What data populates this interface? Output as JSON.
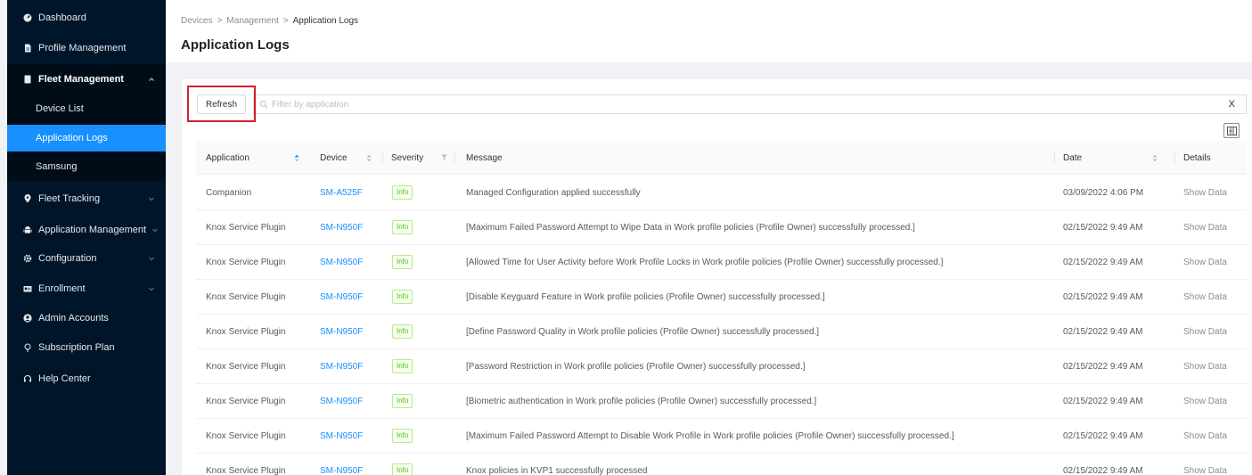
{
  "sidebar": {
    "items": [
      {
        "label": "Dashboard",
        "icon": "dashboard-icon"
      },
      {
        "label": "Profile Management",
        "icon": "file-icon"
      },
      {
        "label": "Fleet Management",
        "icon": "mobile-icon",
        "expanded": true
      },
      {
        "label": "Fleet Tracking",
        "icon": "location-icon"
      },
      {
        "label": "Application Management",
        "icon": "android-icon"
      },
      {
        "label": "Configuration",
        "icon": "gear-icon"
      },
      {
        "label": "Enrollment",
        "icon": "id-card-icon"
      },
      {
        "label": "Admin Accounts",
        "icon": "user-circle-icon"
      },
      {
        "label": "Subscription Plan",
        "icon": "bulb-icon"
      },
      {
        "label": "Help Center",
        "icon": "headset-icon"
      }
    ],
    "fleet_submenu": [
      {
        "label": "Device List",
        "active": false
      },
      {
        "label": "Application Logs",
        "active": true
      },
      {
        "label": "Samsung",
        "active": false
      }
    ]
  },
  "breadcrumb": {
    "items": [
      "Devices",
      "Management",
      "Application Logs"
    ],
    "separator": ">"
  },
  "page": {
    "title": "Application Logs"
  },
  "toolbar": {
    "refresh_label": "Refresh",
    "filter_placeholder": "Filter by application",
    "filter_value": "",
    "clear_label": "X"
  },
  "table": {
    "columns": {
      "application": "Application",
      "device": "Device",
      "severity": "Severity",
      "message": "Message",
      "date": "Date",
      "details": "Details"
    },
    "rows": [
      {
        "application": "Companion",
        "device": "SM-A525F",
        "severity": "Info",
        "message": "Managed Configuration applied successfully",
        "date": "03/09/2022 4:06 PM",
        "details": "Show Data"
      },
      {
        "application": "Knox Service Plugin",
        "device": "SM-N950F",
        "severity": "Info",
        "message": "[Maximum Failed Password Attempt to Wipe Data in Work profile policies (Profile Owner) successfully processed.]",
        "date": "02/15/2022 9:49 AM",
        "details": "Show Data"
      },
      {
        "application": "Knox Service Plugin",
        "device": "SM-N950F",
        "severity": "Info",
        "message": "[Allowed Time for User Activity before Work Profile Locks in Work profile policies (Profile Owner) successfully processed.]",
        "date": "02/15/2022 9:49 AM",
        "details": "Show Data"
      },
      {
        "application": "Knox Service Plugin",
        "device": "SM-N950F",
        "severity": "Info",
        "message": "[Disable Keyguard Feature in Work profile policies (Profile Owner) successfully processed.]",
        "date": "02/15/2022 9:49 AM",
        "details": "Show Data"
      },
      {
        "application": "Knox Service Plugin",
        "device": "SM-N950F",
        "severity": "Info",
        "message": "[Define Password Quality in Work profile policies (Profile Owner) successfully processed.]",
        "date": "02/15/2022 9:49 AM",
        "details": "Show Data"
      },
      {
        "application": "Knox Service Plugin",
        "device": "SM-N950F",
        "severity": "Info",
        "message": "[Password Restriction in Work profile policies (Profile Owner) successfully processed.]",
        "date": "02/15/2022 9:49 AM",
        "details": "Show Data"
      },
      {
        "application": "Knox Service Plugin",
        "device": "SM-N950F",
        "severity": "Info",
        "message": "[Biometric authentication in Work profile policies (Profile Owner) successfully processed.]",
        "date": "02/15/2022 9:49 AM",
        "details": "Show Data"
      },
      {
        "application": "Knox Service Plugin",
        "device": "SM-N950F",
        "severity": "Info",
        "message": "[Maximum Failed Password Attempt to Disable Work Profile in Work profile policies (Profile Owner) successfully processed.]",
        "date": "02/15/2022 9:49 AM",
        "details": "Show Data"
      },
      {
        "application": "Knox Service Plugin",
        "device": "SM-N950F",
        "severity": "Info",
        "message": "Knox policies in KVP1 successfully processed",
        "date": "02/15/2022 9:49 AM",
        "details": "Show Data"
      }
    ]
  },
  "colors": {
    "sidebar_bg": "#001529",
    "active_item": "#1890ff",
    "link": "#1890ff",
    "info_tag": "#52c41a",
    "highlight_box": "#d4202a"
  }
}
